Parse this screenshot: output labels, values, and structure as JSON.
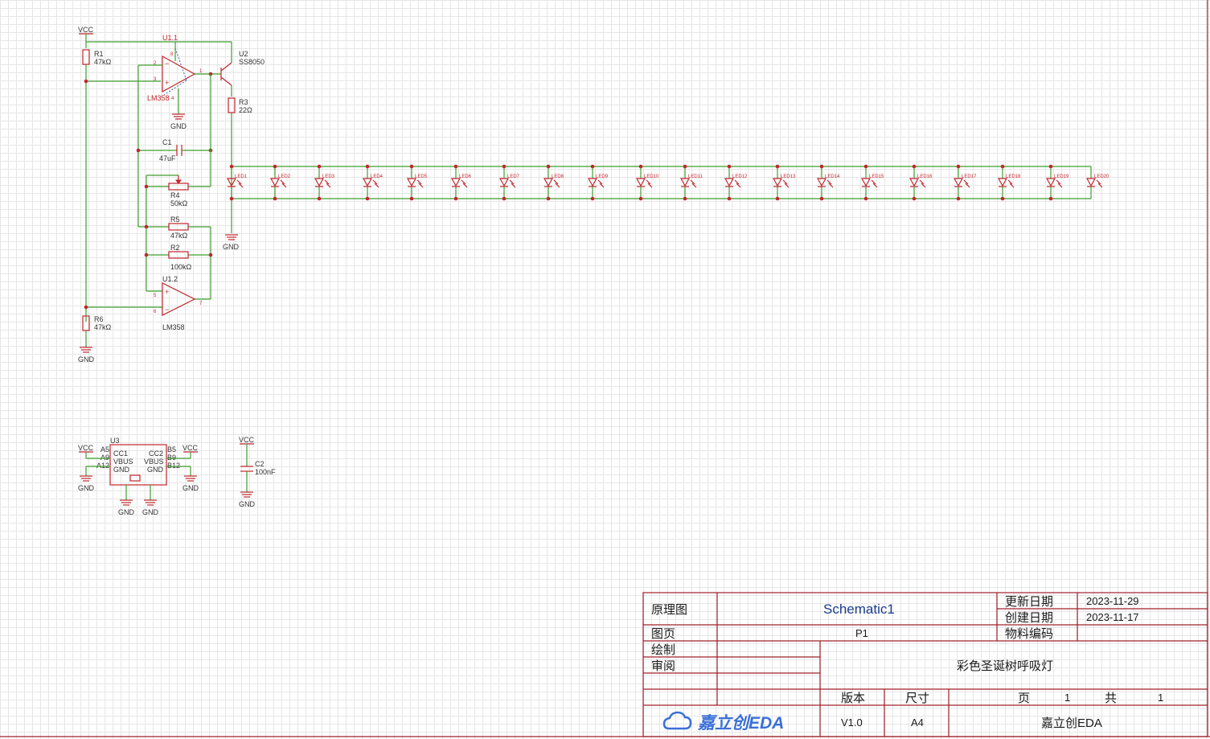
{
  "schematic": {
    "power_labels": {
      "vcc": "VCC",
      "gnd": "GND"
    },
    "parts": {
      "r1": {
        "ref": "R1",
        "value": "47kΩ"
      },
      "u11": {
        "ref": "U1.1",
        "model": "LM358",
        "pins": [
          "2",
          "3",
          "1",
          "8",
          "4"
        ]
      },
      "u2": {
        "ref": "U2",
        "model": "SS8050"
      },
      "r3": {
        "ref": "R3",
        "value": "22Ω"
      },
      "c1": {
        "ref": "C1",
        "value": "47uF"
      },
      "r4": {
        "ref": "R4",
        "value": "50kΩ"
      },
      "r5": {
        "ref": "R5",
        "value": "47kΩ"
      },
      "r2": {
        "ref": "R2",
        "value": "100kΩ"
      },
      "u12": {
        "ref": "U1.2",
        "model": "LM358",
        "pins": [
          "5",
          "6",
          "7"
        ]
      },
      "r6": {
        "ref": "R6",
        "value": "47kΩ"
      },
      "u3": {
        "ref": "U3",
        "pins_left": [
          "A5",
          "A9",
          "A12"
        ],
        "pins_right": [
          "B5",
          "B9",
          "B12"
        ],
        "inner_left": [
          "CC1",
          "VBUS",
          "GND"
        ],
        "inner_right": [
          "CC2",
          "VBUS",
          "GND"
        ]
      },
      "c2": {
        "ref": "C2",
        "value": "100nF"
      }
    },
    "leds": [
      "LED1",
      "LED2",
      "LED3",
      "LED4",
      "LED5",
      "LED6",
      "LED7",
      "LED8",
      "LED9",
      "LED10",
      "LED11",
      "LED12",
      "LED13",
      "LED14",
      "LED15",
      "LED16",
      "LED17",
      "LED18",
      "LED19",
      "LED20"
    ]
  },
  "title_block": {
    "type_label": "原理图",
    "schematic_name": "Schematic1",
    "update_label": "更新日期",
    "update_date": "2023-11-29",
    "create_label": "创建日期",
    "create_date": "2023-11-17",
    "bom_label": "物料编码",
    "page_label": "图页",
    "page_value": "P1",
    "drawn_label": "绘制",
    "review_label": "审阅",
    "project_title": "彩色圣诞树呼吸灯",
    "version_label": "版本",
    "version_value": "V1.0",
    "size_label": "尺寸",
    "size_value": "A4",
    "page_no_label": "页",
    "page_no": "1",
    "total_label": "共",
    "total_pages": "1",
    "logo_text": "嘉立创EDA",
    "company": "嘉立创EDA"
  },
  "colors": {
    "wire": "#3f9e2e",
    "part": "#c0262c",
    "title_border": "#a0202a",
    "logo": "#3a6fd8"
  }
}
